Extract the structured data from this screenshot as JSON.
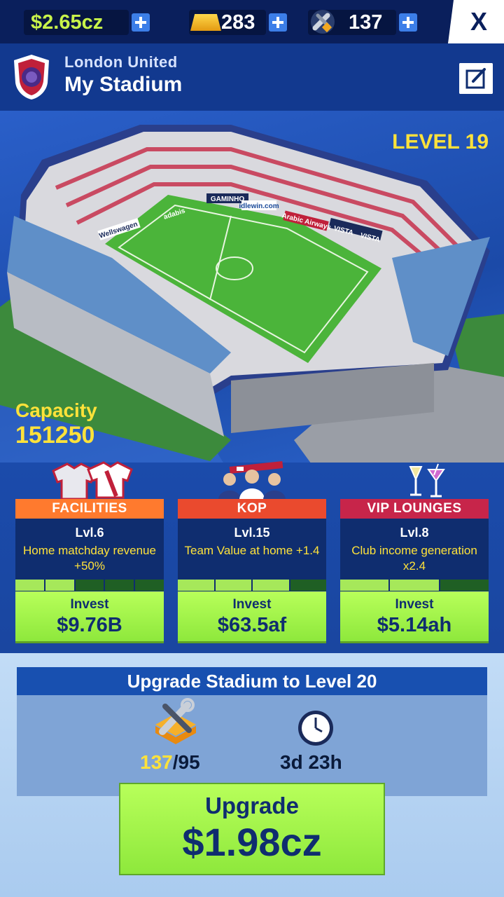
{
  "currencies": {
    "cash": "$2.65cz",
    "gold": "283",
    "tools": "137"
  },
  "header": {
    "club": "London United",
    "title": "My Stadium",
    "close_label": "X"
  },
  "stadium": {
    "level": "LEVEL 19",
    "capacity_label": "Capacity",
    "capacity_value": "151250",
    "ad_boards": [
      "Wellswagen",
      "adabis",
      "GAMINHO",
      "idlewin.com",
      "Arabic Airways",
      "VISTA",
      "VISTA"
    ]
  },
  "cards": [
    {
      "title": "FACILITIES",
      "accent": "#ff7a2e",
      "level": "Lvl.6",
      "desc": "Home matchday revenue +50%",
      "progress_filled": 2,
      "progress_total": 5,
      "invest_label": "Invest",
      "invest_value": "$9.76B"
    },
    {
      "title": "KOP",
      "accent": "#ea4a2e",
      "level": "Lvl.15",
      "desc": "Team Value at home +1.4",
      "progress_filled": 3,
      "progress_total": 4,
      "invest_label": "Invest",
      "invest_value": "$63.5af"
    },
    {
      "title": "VIP LOUNGES",
      "accent": "#c7254a",
      "level": "Lvl.8",
      "desc": "Club income generation x2.4",
      "progress_filled": 2,
      "progress_total": 3,
      "invest_label": "Invest",
      "invest_value": "$5.14ah"
    }
  ],
  "upgrade": {
    "title": "Upgrade Stadium to Level 20",
    "tools_have": "137",
    "tools_need": "/95",
    "time": "3d 23h",
    "button_label": "Upgrade",
    "button_price": "$1.98cz"
  }
}
